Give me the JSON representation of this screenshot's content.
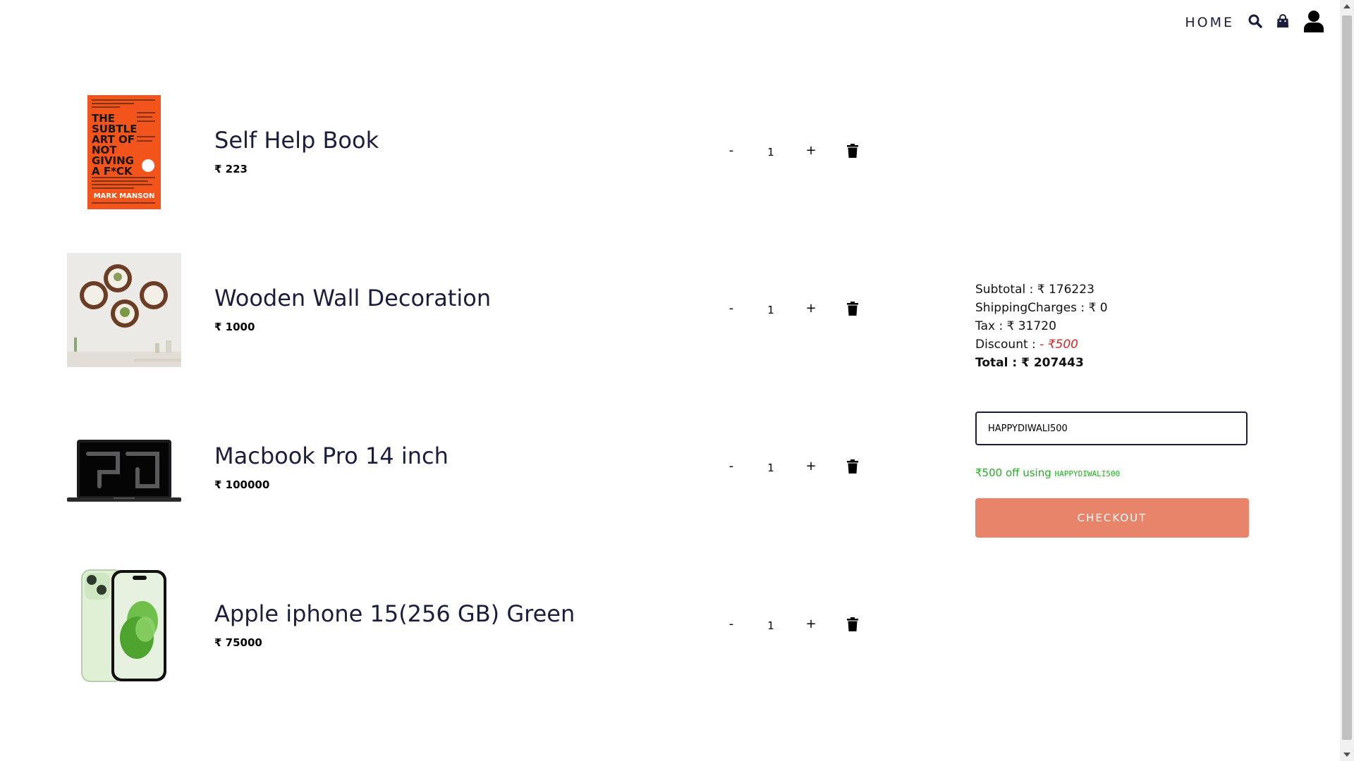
{
  "header": {
    "home_label": "HOME",
    "icons": [
      "search-icon",
      "shopping-bag-icon",
      "user-icon"
    ]
  },
  "cart": {
    "items": [
      {
        "name": "Self Help Book",
        "price": "₹ 223",
        "quantity": "1",
        "image": "book-cover-image"
      },
      {
        "name": "Wooden Wall Decoration",
        "price": "₹ 1000",
        "quantity": "1",
        "image": "wall-decor-image"
      },
      {
        "name": "Macbook Pro 14 inch",
        "price": "₹ 100000",
        "quantity": "1",
        "image": "laptop-image"
      },
      {
        "name": "Apple iphone 15(256 GB) Green",
        "price": "₹ 75000",
        "quantity": "1",
        "image": "phone-image"
      }
    ],
    "minus_label": "-",
    "plus_label": "+"
  },
  "book_cover": {
    "title_lines": [
      "THE",
      "SUBTLE",
      "ART OF",
      "NOT",
      "GIVING",
      "A F*CK"
    ],
    "author": "MARK MANSON"
  },
  "summary": {
    "subtotal_label": "Subtotal : ₹ 176223",
    "shipping_label": "ShippingCharges : ₹ 0",
    "tax_label": "Tax : ₹ 31720",
    "discount_prefix": "Discount : ",
    "discount_value": "- ₹500",
    "total_label": "Total : ₹ 207443"
  },
  "coupon": {
    "value": "HAPPYDIWALI500",
    "message_prefix": "₹500 off using ",
    "message_code": "HAPPYDIWALI500"
  },
  "checkout": {
    "label": "CHECKOUT"
  },
  "colors": {
    "primary_text": "#1b1d3d",
    "checkout_bg": "#e8846a",
    "discount": "#e02424",
    "coupon_success": "#22b022"
  }
}
